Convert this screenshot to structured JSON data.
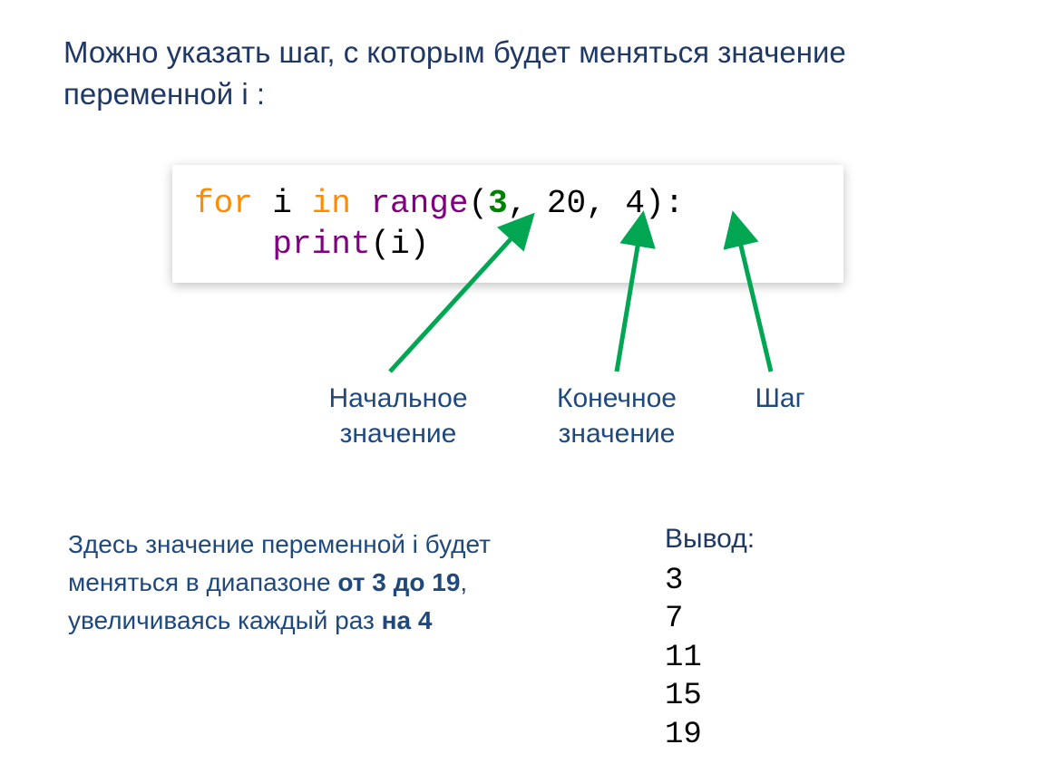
{
  "intro": "Можно указать шаг, с которым будет меняться значение переменной i :",
  "code": {
    "kw_for": "for",
    "var": " i ",
    "kw_in": "in",
    "sp": " ",
    "fn_range": "range",
    "lp": "(",
    "a1": "3",
    "c1": ", ",
    "a2": "20",
    "c2": ", ",
    "a3": "4",
    "rp": ")",
    "colon": ":",
    "indent": "    ",
    "fn_print": "print",
    "lp2": "(",
    "iv": "i",
    "rp2": ")"
  },
  "labels": {
    "start": "Начальное значение",
    "end": "Конечное значение",
    "step": "Шаг"
  },
  "desc": {
    "t1": "Здесь значение переменной i будет меняться в диапазоне ",
    "b1": "от 3 до 19",
    "t2": ", увеличиваясь каждый раз ",
    "b2": "на 4"
  },
  "output": {
    "title": "Вывод:",
    "v1": "3",
    "v2": "7",
    "v3": "11",
    "v4": "15",
    "v5": "19"
  }
}
